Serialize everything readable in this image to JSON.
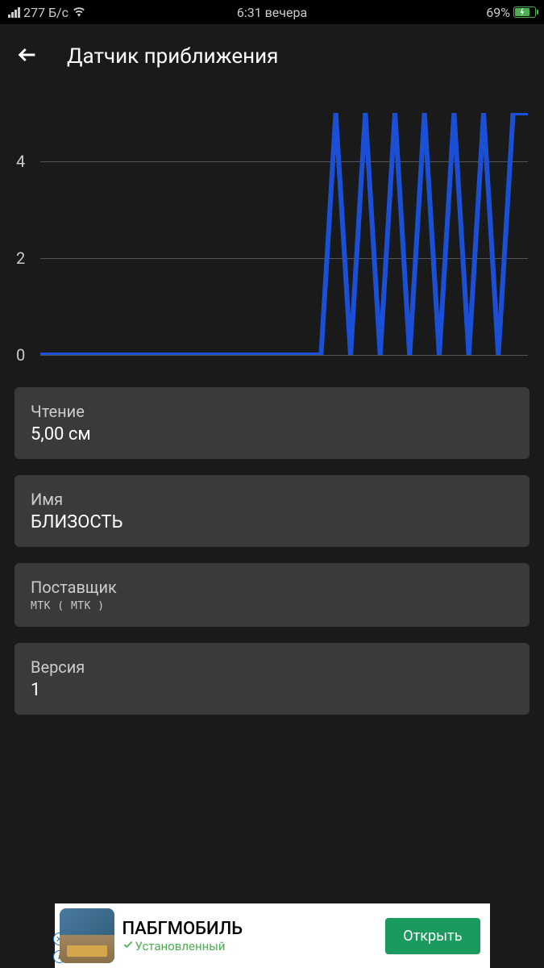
{
  "status_bar": {
    "network_speed": "277 Б/с",
    "time": "6:31 вечера",
    "battery_percent": "69%"
  },
  "header": {
    "title": "Датчик приближения"
  },
  "chart_data": {
    "type": "line",
    "title": "",
    "xlabel": "",
    "ylabel": "",
    "ylim": [
      0,
      5
    ],
    "y_ticks": [
      0,
      2,
      4
    ],
    "x": [
      0,
      1,
      2,
      3,
      4,
      5,
      6,
      7,
      8,
      9,
      10,
      11,
      12,
      13,
      14,
      15,
      16,
      17,
      18,
      19,
      20,
      21,
      22,
      23,
      24,
      25,
      26,
      27,
      28,
      29,
      30,
      31,
      32,
      33
    ],
    "values": [
      0,
      0,
      0,
      0,
      0,
      0,
      0,
      0,
      0,
      0,
      0,
      0,
      0,
      0,
      0,
      0,
      0,
      0,
      0,
      0,
      5,
      0,
      5,
      0,
      5,
      0,
      5,
      0,
      5,
      0,
      5,
      0,
      5,
      5
    ],
    "color": "#1a4fd6"
  },
  "cards": [
    {
      "label": "Чтение",
      "value": "5,00 см",
      "value_class": "card-value"
    },
    {
      "label": "Имя",
      "value": "БЛИЗОСТЬ",
      "value_class": "card-value"
    },
    {
      "label": "Поставщик",
      "value": "MTK ( MTK )",
      "value_class": "card-value-small"
    },
    {
      "label": "Версия",
      "value": "1",
      "value_class": "card-value"
    }
  ],
  "ad": {
    "title": "ПАБГМОБИЛЬ",
    "subtitle": "Установленный",
    "button": "Открыть"
  }
}
